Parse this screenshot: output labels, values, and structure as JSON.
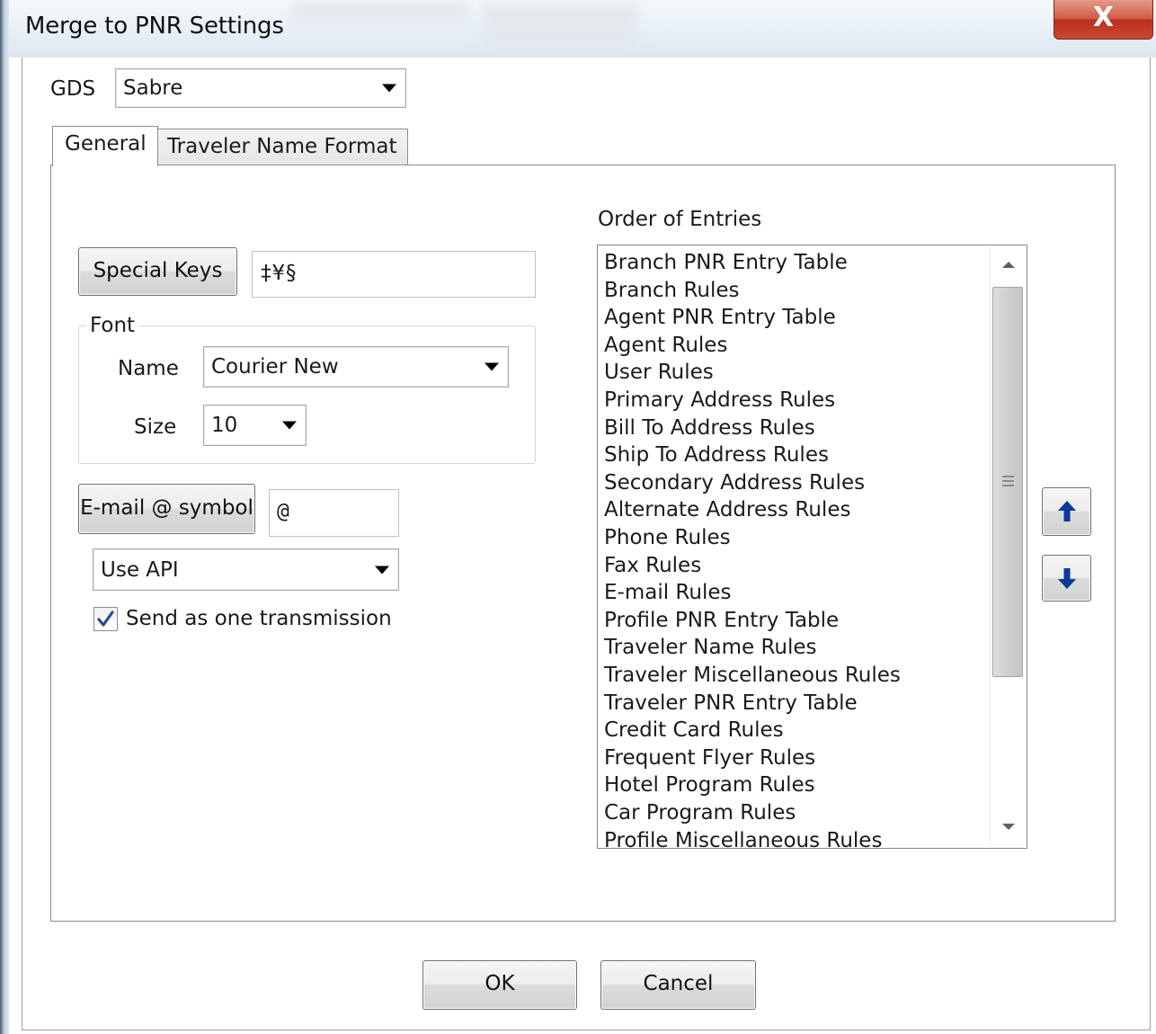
{
  "window": {
    "title": "Merge to PNR Settings",
    "close_glyph": "X"
  },
  "gds": {
    "label": "GDS",
    "value": "Sabre"
  },
  "tabs": [
    {
      "label": "General",
      "selected": true
    },
    {
      "label": "Traveler Name Format",
      "selected": false
    }
  ],
  "general": {
    "special_keys_label": "Special Keys",
    "special_keys_value": "‡¥§",
    "font": {
      "group_label": "Font",
      "name_label": "Name",
      "name_value": "Courier New",
      "size_label": "Size",
      "size_value": "10"
    },
    "email_symbol_label": "E-mail @ symbol",
    "email_symbol_value": "@",
    "api_mode_value": "Use API",
    "send_one_transmission": {
      "label": "Send as one transmission",
      "checked": true
    }
  },
  "order_of_entries": {
    "label": "Order of Entries",
    "items": [
      "Branch PNR Entry Table",
      "Branch Rules",
      "Agent PNR Entry Table",
      "Agent Rules",
      "User Rules",
      "Primary Address Rules",
      "Bill To Address Rules",
      "Ship To Address Rules",
      "Secondary Address Rules",
      "Alternate Address Rules",
      "Phone Rules",
      "Fax Rules",
      "E-mail Rules",
      "Profile PNR Entry Table",
      "Traveler Name Rules",
      "Traveler Miscellaneous Rules",
      "Traveler PNR Entry Table",
      "Credit Card Rules",
      "Frequent Flyer Rules",
      "Hotel Program Rules",
      "Car Program Rules",
      "Profile Miscellaneous Rules"
    ]
  },
  "move_buttons": {
    "up_icon": "arrow-up-icon",
    "down_icon": "arrow-down-icon",
    "color": "#0a3a9a"
  },
  "footer": {
    "ok_label": "OK",
    "cancel_label": "Cancel"
  }
}
